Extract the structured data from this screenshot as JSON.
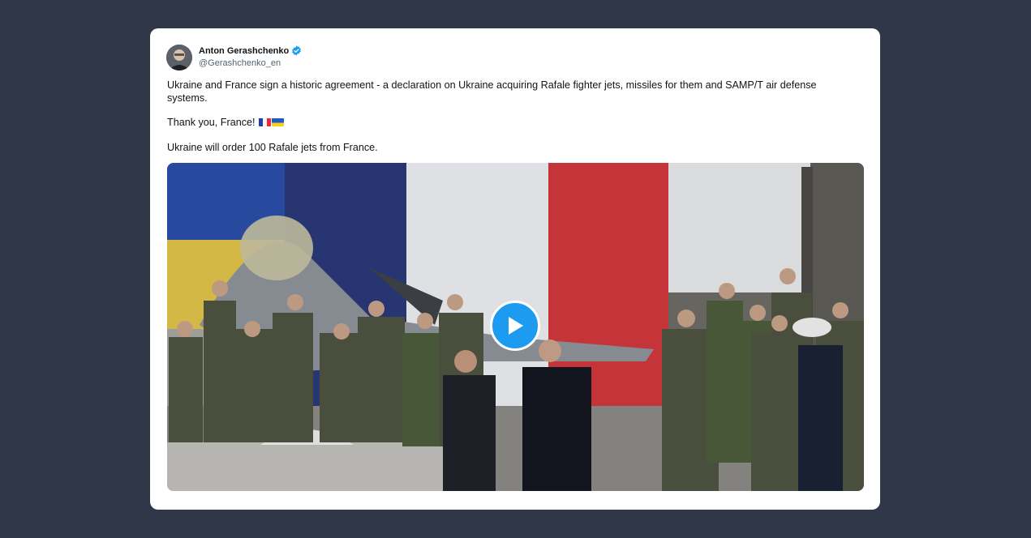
{
  "author": {
    "name": "Anton Gerashchenko",
    "handle": "@Gerashchenko_en",
    "verified_icon": "verified-badge-icon",
    "verified_color": "#1d9bf0"
  },
  "tweet": {
    "line1": "Ukraine and France sign a historic agreement - a declaration on Ukraine acquiring Rafale fighter jets, missiles for them and SAMP/T air defense systems.",
    "line2": "Thank you, France!",
    "line2_flags": [
      "france-flag-icon",
      "ukraine-flag-icon"
    ],
    "line3": "Ukraine will order 100 Rafale jets from France."
  },
  "media": {
    "type": "video",
    "play_icon": "play-icon",
    "accent": "#1d9bf0"
  }
}
